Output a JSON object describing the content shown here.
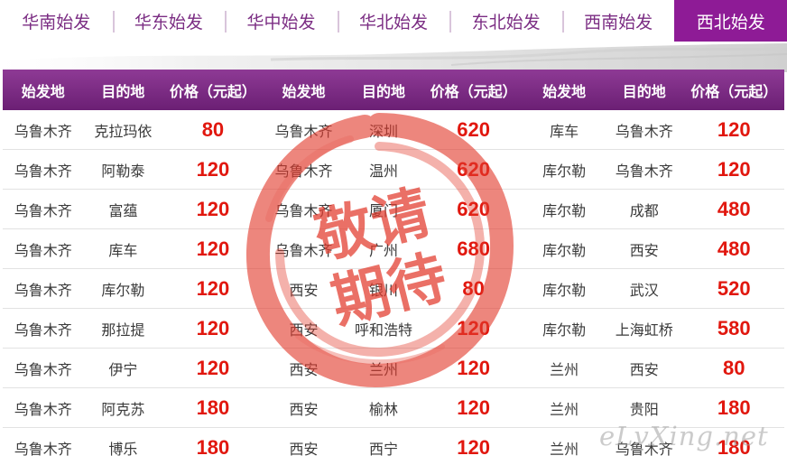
{
  "tabs": [
    {
      "label": "华南始发",
      "active": false
    },
    {
      "label": "华东始发",
      "active": false
    },
    {
      "label": "华中始发",
      "active": false
    },
    {
      "label": "华北始发",
      "active": false
    },
    {
      "label": "东北始发",
      "active": false
    },
    {
      "label": "西南始发",
      "active": false
    },
    {
      "label": "西北始发",
      "active": true
    }
  ],
  "table": {
    "headers": [
      "始发地",
      "目的地",
      "价格（元起）",
      "始发地",
      "目的地",
      "价格（元起）",
      "始发地",
      "目的地",
      "价格（元起）"
    ],
    "rows": [
      [
        "乌鲁木齐",
        "克拉玛依",
        "80",
        "乌鲁木齐",
        "深圳",
        "620",
        "库车",
        "乌鲁木齐",
        "120"
      ],
      [
        "乌鲁木齐",
        "阿勒泰",
        "120",
        "乌鲁木齐",
        "温州",
        "620",
        "库尔勒",
        "乌鲁木齐",
        "120"
      ],
      [
        "乌鲁木齐",
        "富蕴",
        "120",
        "乌鲁木齐",
        "厦门",
        "620",
        "库尔勒",
        "成都",
        "480"
      ],
      [
        "乌鲁木齐",
        "库车",
        "120",
        "乌鲁木齐",
        "广州",
        "680",
        "库尔勒",
        "西安",
        "480"
      ],
      [
        "乌鲁木齐",
        "库尔勒",
        "120",
        "西安",
        "银川",
        "80",
        "库尔勒",
        "武汉",
        "520"
      ],
      [
        "乌鲁木齐",
        "那拉提",
        "120",
        "西安",
        "呼和浩特",
        "120",
        "库尔勒",
        "上海虹桥",
        "580"
      ],
      [
        "乌鲁木齐",
        "伊宁",
        "120",
        "西安",
        "兰州",
        "120",
        "兰州",
        "西安",
        "80"
      ],
      [
        "乌鲁木齐",
        "阿克苏",
        "180",
        "西安",
        "榆林",
        "120",
        "兰州",
        "贵阳",
        "180"
      ],
      [
        "乌鲁木齐",
        "博乐",
        "180",
        "西安",
        "西宁",
        "120",
        "兰州",
        "乌鲁木齐",
        "180"
      ]
    ]
  },
  "stamp": {
    "line1": "敬请",
    "line2": "期待"
  },
  "watermark": "eLvXing.net",
  "colors": {
    "accent": "#8e1b96",
    "price": "#e1170e",
    "stamp": "#e23a2c"
  }
}
